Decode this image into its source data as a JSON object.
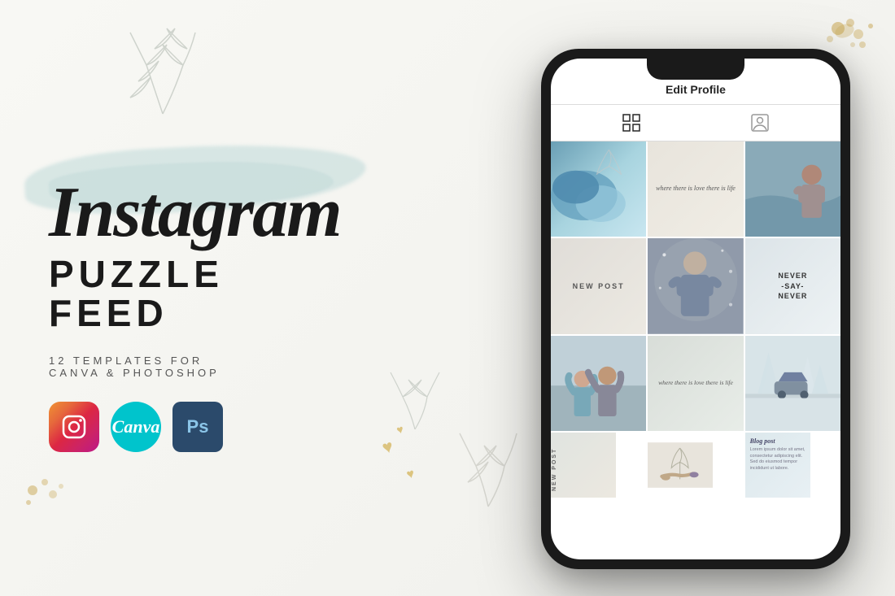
{
  "page": {
    "title": "Instagram Puzzle Feed",
    "background": "#f5f5f0"
  },
  "left": {
    "title_script": "Instagram",
    "title_line1": "PUZZLE",
    "title_line2": "FEED",
    "subtitle": "12  TEMPLATES  FOR",
    "subtitle2": "CANVA & PHOTOSHOP",
    "icons": [
      {
        "name": "instagram",
        "label": "Instagram"
      },
      {
        "name": "canva",
        "label": "Canva"
      },
      {
        "name": "photoshop",
        "label": "Ps"
      }
    ]
  },
  "phone": {
    "header_title": "Edit Profile",
    "tabs": [
      "grid",
      "person"
    ],
    "grid": [
      {
        "id": 1,
        "type": "photo-blue",
        "text": ""
      },
      {
        "id": 2,
        "type": "text-overlay",
        "text": "where there\nis love\nthere is life"
      },
      {
        "id": 3,
        "type": "photo-person",
        "text": ""
      },
      {
        "id": 4,
        "type": "label",
        "text": "NEW POST"
      },
      {
        "id": 5,
        "type": "photo-person2",
        "text": ""
      },
      {
        "id": 6,
        "type": "label",
        "text": "NEVER\n-SAY-\nNEVER"
      },
      {
        "id": 7,
        "type": "photo-person3",
        "text": ""
      },
      {
        "id": 8,
        "type": "text-overlay2",
        "text": "where there\nis love\nthere is life"
      },
      {
        "id": 9,
        "type": "photo-winter",
        "text": ""
      }
    ]
  }
}
